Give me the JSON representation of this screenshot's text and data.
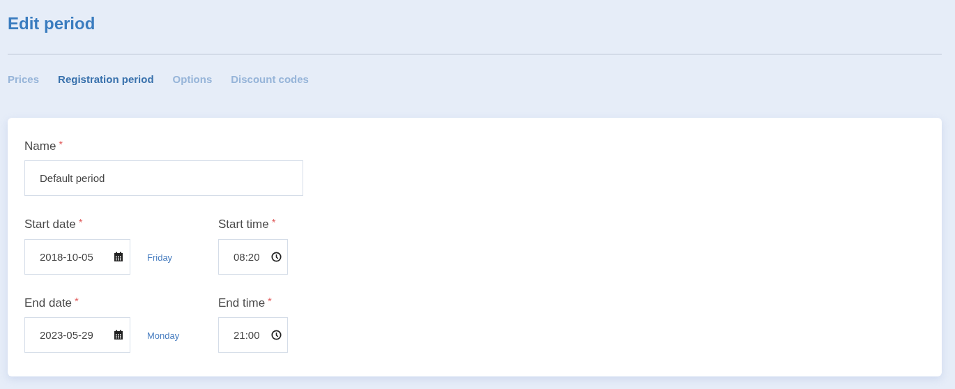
{
  "page": {
    "title": "Edit period"
  },
  "tabs": [
    {
      "label": "Prices",
      "selected": false
    },
    {
      "label": "Registration period",
      "selected": true
    },
    {
      "label": "Options",
      "selected": false
    },
    {
      "label": "Discount codes",
      "selected": false
    }
  ],
  "form": {
    "name": {
      "label": "Name",
      "required_mark": "*",
      "value": "Default period"
    },
    "rows": [
      {
        "date": {
          "label": "Start date",
          "required_mark": "*",
          "value": "2018-10-05",
          "weekday": "Friday"
        },
        "time": {
          "label": "Start time",
          "required_mark": "*",
          "value": "08:20"
        }
      },
      {
        "date": {
          "label": "End date",
          "required_mark": "*",
          "value": "2023-05-29",
          "weekday": "Monday"
        },
        "time": {
          "label": "End time",
          "required_mark": "*",
          "value": "21:00"
        }
      }
    ]
  }
}
